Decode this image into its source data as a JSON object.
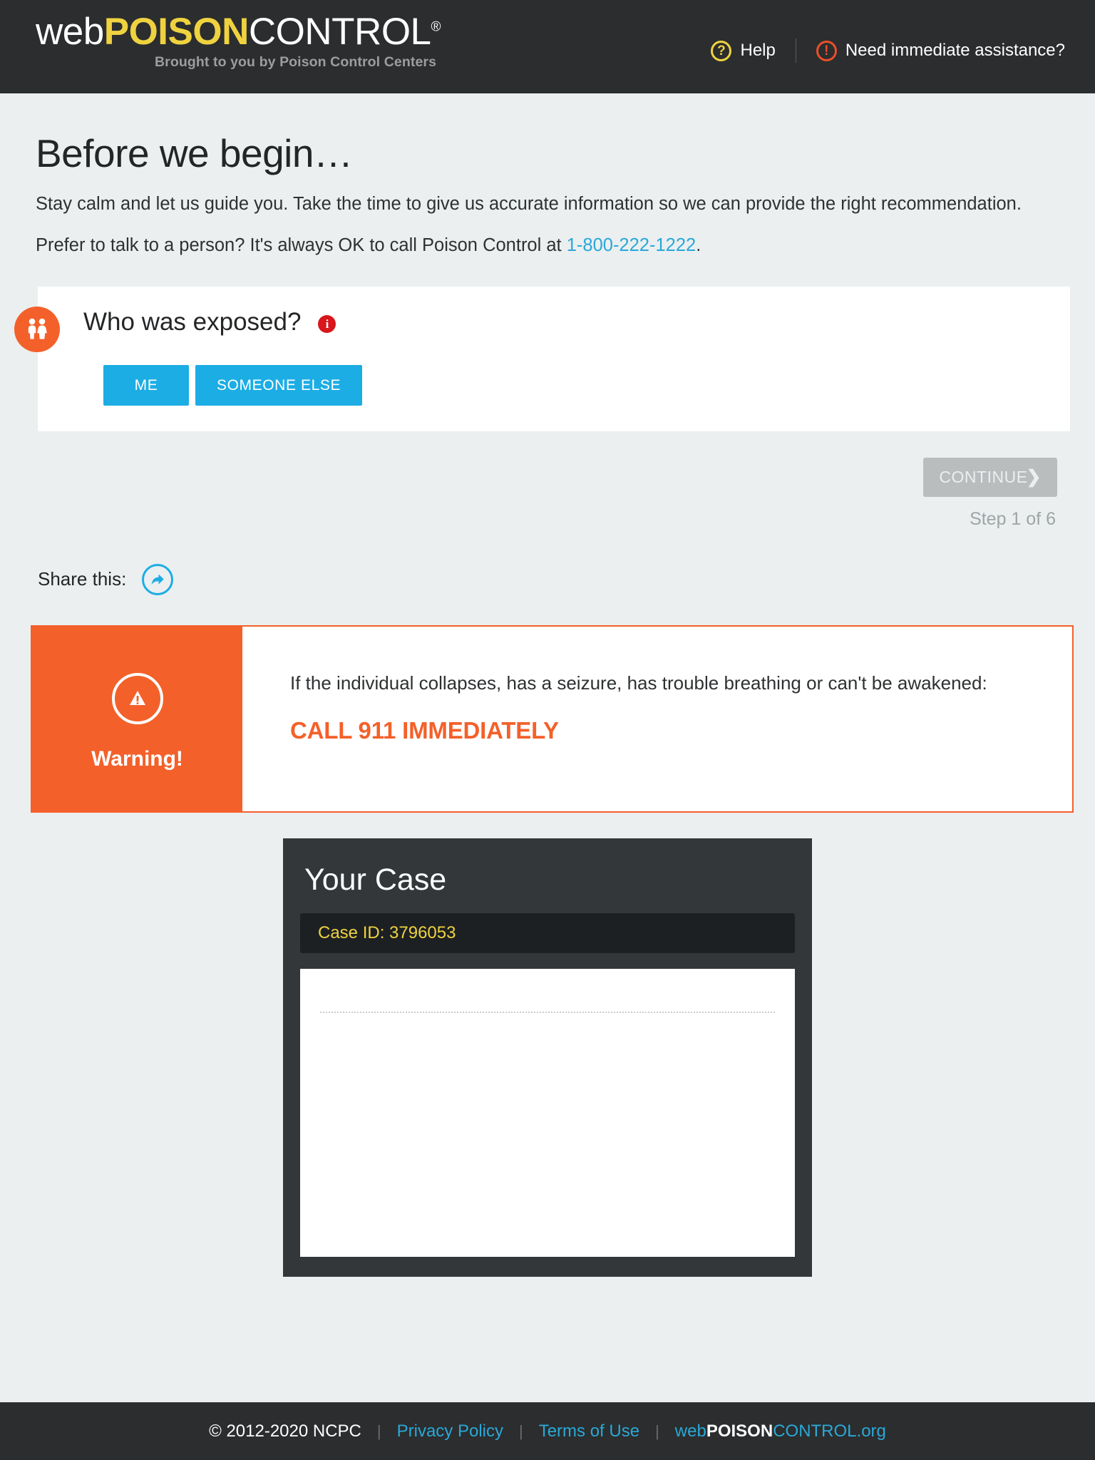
{
  "header": {
    "brand": {
      "part1": "web",
      "part2": "POISON",
      "part3": "CONTROL",
      "registered": "®",
      "tagline": "Brought to you by Poison Control Centers"
    },
    "help_label": "Help",
    "help_icon": "question-circle-icon",
    "assistance_label": "Need immediate assistance?",
    "assistance_icon": "exclamation-circle-icon"
  },
  "main": {
    "title": "Before we begin…",
    "intro_1": "Stay calm and let us guide you. Take the time to give us accurate information so we can provide the right recommendation.",
    "intro_2_before": "Prefer to talk to a person? It's always OK to call Poison Control at ",
    "phone": "1-800-222-1222",
    "intro_2_after": "."
  },
  "question": {
    "icon": "two-people-icon",
    "text": "Who was exposed?",
    "info_icon": "info-icon",
    "options": [
      {
        "label": "ME"
      },
      {
        "label": "SOMEONE ELSE"
      }
    ]
  },
  "navigation": {
    "continue_label": "CONTINUE",
    "continue_chevron": "❯",
    "step_text": "Step 1 of 6"
  },
  "share": {
    "label": "Share this:",
    "icon": "share-arrow-icon"
  },
  "warning": {
    "icon": "warning-triangle-icon",
    "heading": "Warning!",
    "body": "If the individual collapses, has a seizure, has trouble breathing or can't be awakened:",
    "call": "CALL 911 IMMEDIATELY"
  },
  "case": {
    "title": "Your Case",
    "case_id_label": "Case ID: 3796053"
  },
  "footer": {
    "copyright": "© 2012-2020 NCPC",
    "privacy": "Privacy Policy",
    "terms": "Terms of Use",
    "site_web": "web",
    "site_poison": "POISON",
    "site_control": "CONTROL.org",
    "separator": "|"
  },
  "colors": {
    "header_bg": "#2b2d2e",
    "page_bg": "#ebeff0",
    "brand_yellow": "#efd240",
    "accent_cyan": "#1cade4",
    "link_blue": "#2aa8d8",
    "warning_orange": "#f4602a",
    "info_red": "#d8161b",
    "disabled_gray": "#b9bdbe",
    "case_panel": "#33373a"
  }
}
